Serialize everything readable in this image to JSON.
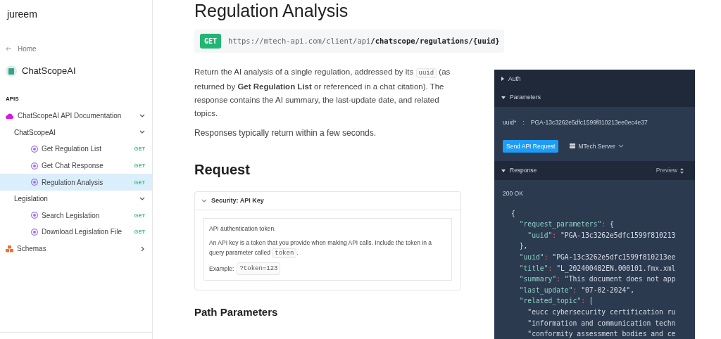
{
  "brand": "jureem",
  "back_link": "Home",
  "project": {
    "name": "ChatScopeAI"
  },
  "sidebar": {
    "section_label": "APIS",
    "items": [
      {
        "label": "ChatScopeAI API Documentation",
        "kind": "api",
        "expanded": true,
        "children": [
          {
            "label": "ChatScopeAI",
            "kind": "group",
            "expanded": true,
            "children": [
              {
                "label": "Get Regulation List",
                "kind": "endpoint",
                "method": "GET",
                "selected": false
              },
              {
                "label": "Get Chat Response",
                "kind": "endpoint",
                "method": "GET",
                "selected": false
              },
              {
                "label": "Regulation Analysis",
                "kind": "endpoint",
                "method": "GET",
                "selected": true
              }
            ]
          },
          {
            "label": "Legislation",
            "kind": "group",
            "expanded": true,
            "children": [
              {
                "label": "Search Legislation",
                "kind": "endpoint",
                "method": "GET",
                "selected": false
              },
              {
                "label": "Download Legislation File",
                "kind": "endpoint",
                "method": "GET",
                "selected": false
              }
            ]
          }
        ]
      },
      {
        "label": "Schemas",
        "kind": "schemas",
        "expanded": false
      }
    ]
  },
  "page": {
    "title": "Regulation Analysis",
    "endpoint": {
      "method": "GET",
      "url": "https://mtech-api.com/client/api**/chatscope/regulations/{uuid}**"
    },
    "description": [
      "Return the AI analysis of a single regulation, addressed by its",
      "uuid",
      "(as returned by **Get Regulation List** or referenced in a chat citation). The response contains the AI summary, the last-update date, and related topics."
    ],
    "note": "Responses typically return within a few seconds.",
    "request_heading": "Request",
    "security": {
      "title": "Security: API Key",
      "expanded": true,
      "summary": "API authentication token.",
      "text": "An API key is a token that you provide when making API calls. Include the token in a query parameter called",
      "code": "token",
      "after": ".",
      "example_label": "Example:",
      "example": "?token=123"
    },
    "path_heading": "Path Parameters"
  },
  "console": {
    "sections": [
      {
        "label": "Auth",
        "expanded": false
      },
      {
        "label": "Parameters",
        "expanded": true
      }
    ],
    "param": {
      "name": "uuid*",
      "separator": ":",
      "value": "PGA-13c3262e5dfc1599f810213ee0ec4e37"
    },
    "send_button": "Send API Request",
    "server": "MTech Server",
    "response": {
      "label": "Response",
      "expanded": true,
      "view": "Preview",
      "status": "200 OK",
      "lines": [
        "{",
        "  \"request_parameters\": {",
        "    \"uuid\": \"PGA-13c3262e5dfc1599f810213",
        "  },",
        "  \"uuid\": \"PGA-13c3262e5dfc1599f810213ee",
        "  \"title\": \"L_202400482EN.000101.fmx.xml",
        "  \"summary\": \"This document does not app",
        "  \"last_update\": \"07-02-2024\",",
        "  \"related_topic\": [",
        "    \"eucc cybersecurity certification ru",
        "    \"information and communication techn",
        "    \"conformity assessment bodies and ce"
      ]
    }
  }
}
